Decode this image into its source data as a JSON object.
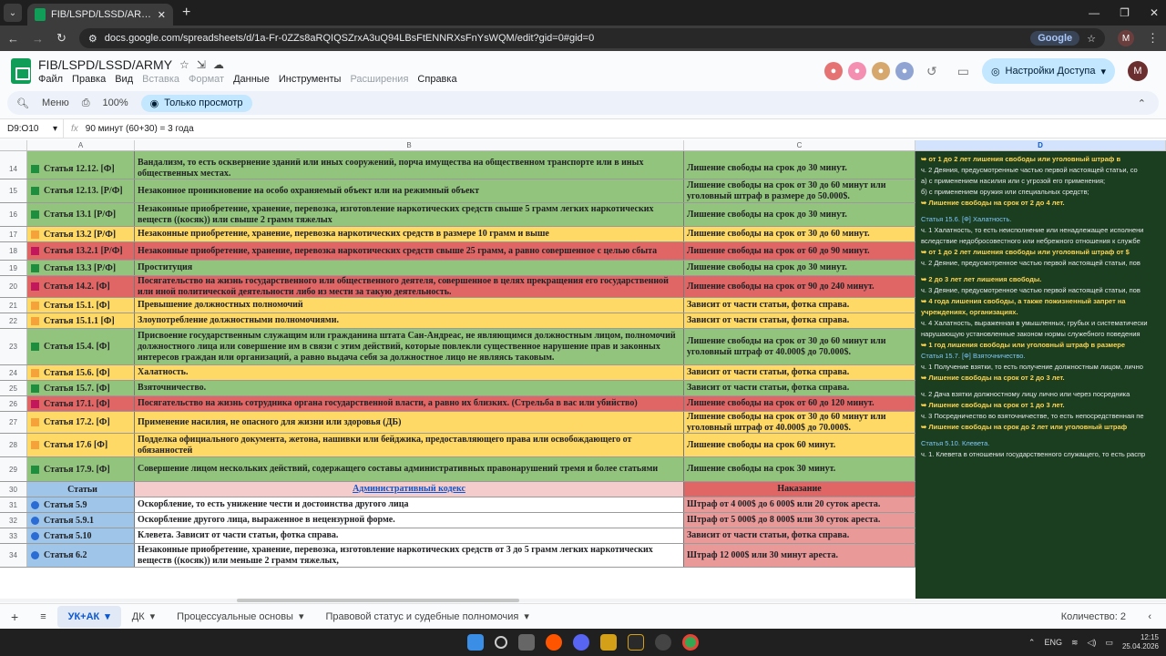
{
  "browser": {
    "tab_title": "FIB/LSPD/LSSD/ARMY - Google",
    "url": "docs.google.com/spreadsheets/d/1a-Fr-0ZZs8aRQIQSZrxA3uQ94LBsFtENNRXsFnYsWQM/edit?gid=0#gid=0",
    "search_chip": "Google",
    "profile_letter": "M"
  },
  "doc": {
    "title": "FIB/LSPD/LSSD/ARMY",
    "menus": [
      "Файл",
      "Правка",
      "Вид",
      "Вставка",
      "Формат",
      "Данные",
      "Инструменты",
      "Расширения",
      "Справка"
    ],
    "share_label": "Настройки Доступа",
    "user_letter": "M"
  },
  "toolbar": {
    "menu_label": "Меню",
    "zoom": "100%",
    "view_only": "Только просмотр"
  },
  "formula": {
    "cell_ref": "D9:O10",
    "content": "90 минут (60+30) = 3 года"
  },
  "columns": [
    "A",
    "B",
    "C",
    "D"
  ],
  "rows": [
    {
      "n": "14",
      "a": "Статья 12.12. [Ф]",
      "b": "Вандализм, то есть осквернение зданий или иных сооружений, порча имущества на общественном транспорте или в иных общественных местах.",
      "c": "Лишение свободы на срок до 30 минут.",
      "color": "g",
      "mark": "g"
    },
    {
      "n": "15",
      "a": "Статья 12.13. [Р/Ф]",
      "b": "Незаконное проникновение на особо охраняемый объект или на режимный объект",
      "c": "Лишение свободы на срок от 30 до 60 минут или уголовный штраф в размере до 50.000$.",
      "color": "g",
      "mark": "g"
    },
    {
      "n": "16",
      "a": "Статья 13.1 [Р/Ф]",
      "b": "Незаконные приобретение, хранение, перевозка, изготовление наркотических средств свыше 5 грамм легких наркотических веществ ((косяк)) или свыше 2 грамм тяжелых",
      "c": "Лишение свободы на срок до 30 минут.",
      "color": "g",
      "mark": "g"
    },
    {
      "n": "17",
      "a": "Статья 13.2 [Р/Ф]",
      "b": "Незаконные приобретение, хранение, перевозка наркотических средств в размере 10 грамм и выше",
      "c": "Лишение свободы на срок от 30 до 60 минут.",
      "color": "y",
      "mark": "o"
    },
    {
      "n": "18",
      "a": "Статья 13.2.1 [Р/Ф]",
      "b": "Незаконные приобретение, хранение, перевозка наркотических средств свыше 25 грамм, а равно совершенное с целью сбыта",
      "c": "Лишение свободы на срок от 60 до 90 минут.",
      "color": "r",
      "mark": "r"
    },
    {
      "n": "19",
      "a": "Статья 13.3 [Р/Ф]",
      "b": "Проституция",
      "c": "Лишение свободы на срок до 30 минут.",
      "color": "g",
      "mark": "g"
    },
    {
      "n": "20",
      "a": "Статья 14.2. [Ф]",
      "b": "Посягательство на жизнь государственного или общественного деятеля, совершенное в целях прекращения его государственной или иной политической деятельности либо из мести за такую деятельность.",
      "c": "Лишение свободы на срок от 90 до 240 минут.",
      "color": "r",
      "mark": "r"
    },
    {
      "n": "21",
      "a": "Статья 15.1. [Ф]",
      "b": "Превышение должностных полномочий",
      "c": "Зависит от части статьи, фотка справа.",
      "color": "y",
      "mark": "o"
    },
    {
      "n": "22",
      "a": "Статья 15.1.1 [Ф]",
      "b": "Злоупотребление должностными полномочиями.",
      "c": "Зависит от части статьи, фотка справа.",
      "color": "y",
      "mark": "o"
    },
    {
      "n": "23",
      "a": "Статья 15.4. [Ф]",
      "b": "Присвоение государственным служащим или гражданина штата Сан-Андреас, не являющимся должностным лицом, полномочий должностного лица или совершение им в связи с этим действий, которые повлекли существенное нарушение прав и законных интересов граждан или организаций, а равно выдача себя за должностное лицо не являясь таковым.",
      "c": "Лишение свободы на срок от 30 до 60 минут или уголовный штраф от 40.000$ до 70.000$.",
      "color": "g",
      "mark": "g"
    },
    {
      "n": "24",
      "a": "Статья 15.6. [Ф]",
      "b": "Халатность.",
      "c": "Зависит от части статьи, фотка справа.",
      "color": "y",
      "mark": "o"
    },
    {
      "n": "25",
      "a": "Статья 15.7. [Ф]",
      "b": "Взяточничество.",
      "c": "Зависит от части статьи, фотка справа.",
      "color": "g",
      "mark": "g"
    },
    {
      "n": "26",
      "a": "Статья 17.1. [Ф]",
      "b": "Посягательство на жизнь сотрудника органа государственной власти, а равно их близких. (Стрельба в вас или убийство)",
      "c": "Лишение свободы на срок от 60 до 120 минут.",
      "color": "r",
      "mark": "r"
    },
    {
      "n": "27",
      "a": "Статья 17.2. [Ф]",
      "b": "Применение насилия, не опасного для жизни или здоровья (ДБ)",
      "c": "Лишение свободы на срок от 30 до 60 минут или уголовный штраф от 40.000$ до 70.000$.",
      "color": "y",
      "mark": "o"
    },
    {
      "n": "28",
      "a": "Статья 17.6 [Ф]",
      "b": "Подделка официального документа, жетона, нашивки или бейджика, предоставляющего права или освобождающего от обязанностей",
      "c": "Лишение свободы на срок 60 минут.",
      "color": "y",
      "mark": "o"
    },
    {
      "n": "29",
      "a": "Статья 17.9. [Ф]",
      "b": "Совершение лицом нескольких действий, содержащего составы административных правонарушений тремя и более статьями",
      "c": "Лишение свободы на срок 30 минут.",
      "color": "g",
      "mark": "g"
    }
  ],
  "ak_header": {
    "n": "30",
    "a": "Статьи",
    "b": "Административный кодекс",
    "c": "Наказание"
  },
  "ak_rows": [
    {
      "n": "31",
      "a": "Статья 5.9",
      "b": "Оскорбление, то есть унижение чести и достоинства другого лица",
      "c": "Штраф от 4 000$ до 6 000$ или 20 суток ареста."
    },
    {
      "n": "32",
      "a": "Статья 5.9.1",
      "b": "Оскорбление другого лица, выраженное в нецензурной форме.",
      "c": "Штраф от 5 000$ до 8 000$ или 30 суток ареста."
    },
    {
      "n": "33",
      "a": "Статья 5.10",
      "b": "Клевета. Зависит от части статьи, фотка справа.",
      "c": "Зависит от части статьи, фотка справа."
    },
    {
      "n": "34",
      "a": "Статья 6.2",
      "b": "Незаконные приобретение, хранение, перевозка, изготовление наркотических средств от 3 до 5 грамм легких наркотических веществ ((косяк)) или меньше 2 грамм тяжелых,",
      "c": "Штраф 12 000$ или 30 минут ареста."
    }
  ],
  "side_image": [
    {
      "t": "➥ от 1 до 2 лет лишения свободы или уголовный штраф в",
      "cls": "yl"
    },
    {
      "t": "ч. 2 Деяния, предусмотренные частью первой настоящей статьи, со",
      "cls": ""
    },
    {
      "t": "а) с применением насилия или с угрозой его применения;",
      "cls": ""
    },
    {
      "t": "б) с применением оружия или специальных средств;",
      "cls": ""
    },
    {
      "t": "➥ Лишение свободы на срок от 2 до 4 лет.",
      "cls": "yl"
    },
    {
      "t": "Статья 15.6. [Ф] Халатность.",
      "cls": "bl"
    },
    {
      "t": "ч. 1 Халатность, то есть неисполнение или ненадлежащее исполнени",
      "cls": ""
    },
    {
      "t": "вследствие недобросовестного или небрежного отношения к службе",
      "cls": ""
    },
    {
      "t": "➥ от 1 до 2 лет лишения свободы или уголовный штраф от $",
      "cls": "yl"
    },
    {
      "t": "ч. 2 Деяние, предусмотренное частью первой настоящей статьи, пов",
      "cls": ""
    },
    {
      "t": "➥ 2 до 3 лет лет лишения свободы.",
      "cls": "yl"
    },
    {
      "t": "ч. 3 Деяние, предусмотренное частью первой настоящей статьи, пов",
      "cls": ""
    },
    {
      "t": "➥ 4 года лишения свободы, а также пожизненный запрет на",
      "cls": "yl"
    },
    {
      "t": "учреждениях, организациях.",
      "cls": "yl"
    },
    {
      "t": "ч. 4 Халатность, выраженная в умышленных, грубых и систематически",
      "cls": ""
    },
    {
      "t": "нарушающую установленные законом нормы служебного поведения",
      "cls": ""
    },
    {
      "t": "➥ 1 год лишения свободы или уголовный штраф в размере",
      "cls": "yl"
    },
    {
      "t": "Статья 15.7. [Ф] Взяточничество.",
      "cls": "bl"
    },
    {
      "t": "ч. 1 Получение взятки, то есть получение должностным лицом, лично",
      "cls": ""
    },
    {
      "t": "➥ Лишение свободы на срок от 2 до 3 лет.",
      "cls": "yl"
    },
    {
      "t": "ч. 2 Дача взятки должностному лицу лично или через посредника",
      "cls": ""
    },
    {
      "t": "➥ Лишение свободы на срок от 1 до 3 лет.",
      "cls": "yl"
    },
    {
      "t": "ч. 3 Посредничество во взяточничестве, то есть непосредственная пе",
      "cls": ""
    },
    {
      "t": "➥ Лишение свободы на срок до 2 лет или уголовный штраф",
      "cls": "yl"
    },
    {
      "t": "Статья 5.10. Клевета.",
      "cls": "bl"
    },
    {
      "t": "ч. 1. Клевета в отношении государственного служащего, то есть распр",
      "cls": ""
    }
  ],
  "sheet_tabs": [
    "УК+АК",
    "ДК",
    "Процессуальные основы",
    "Правовой статус и судебные полномочия"
  ],
  "status": {
    "count_label": "Количество: 2"
  },
  "tray": {
    "lang": "ENG",
    "time": "12:15",
    "date": "25.04.2026"
  }
}
